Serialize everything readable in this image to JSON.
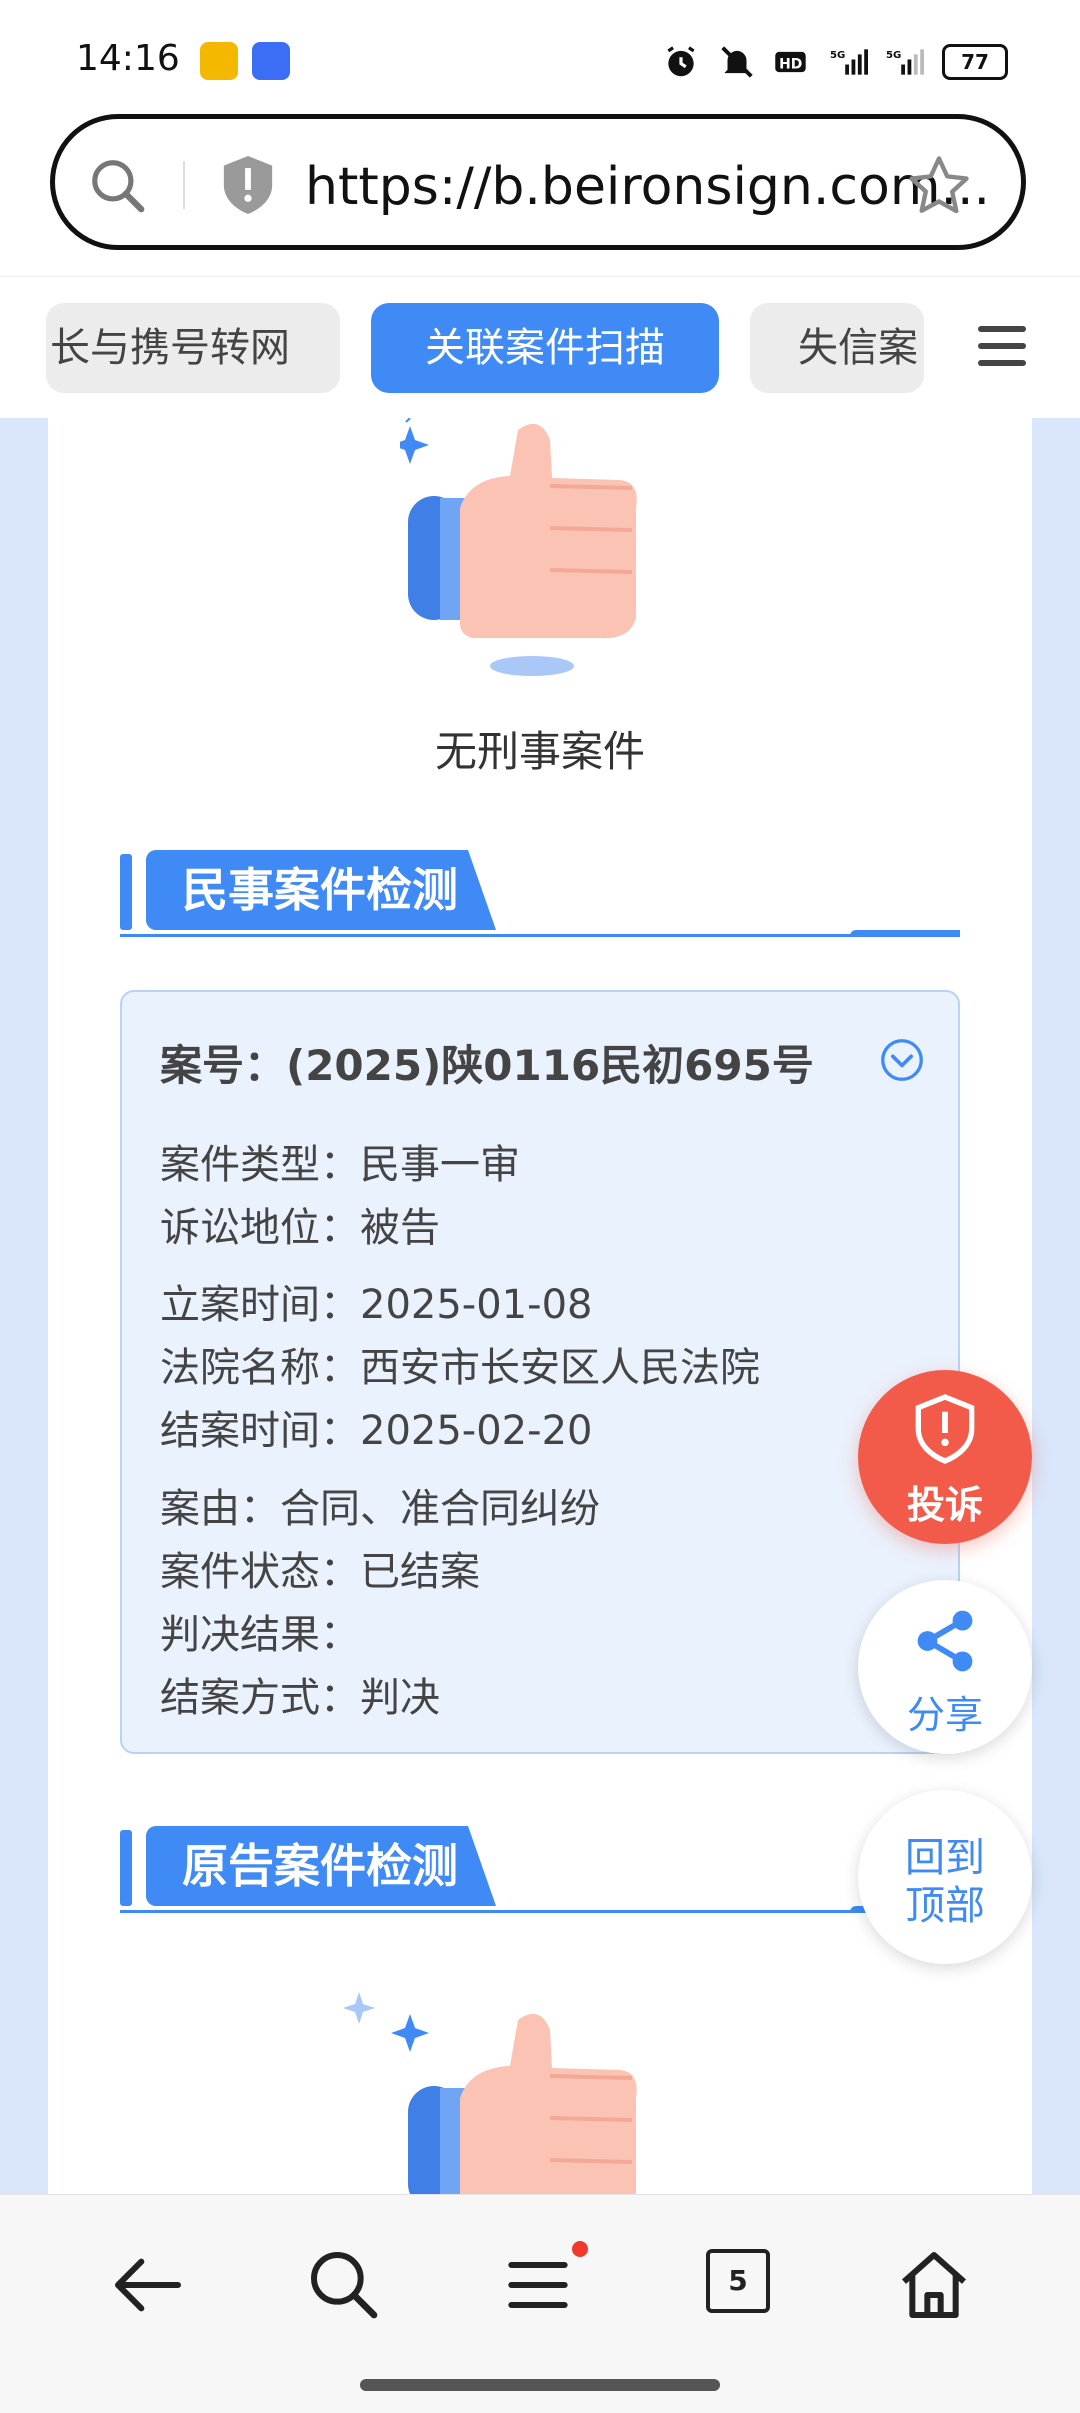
{
  "status_bar": {
    "time": "14:16",
    "battery": "77",
    "icons": [
      "app-game-icon",
      "app-chat-icon",
      "alarm-icon",
      "mute-icon",
      "hd-icon",
      "5g-signal-icon",
      "5g-signal-icon",
      "battery-icon"
    ]
  },
  "address_bar": {
    "url": "https://b.beironsign.com...",
    "icons": [
      "search-icon",
      "shield-icon",
      "star-icon"
    ]
  },
  "tabs": [
    {
      "label": "长与携号转网",
      "active": false
    },
    {
      "label": "关联案件扫描",
      "active": true
    },
    {
      "label": "失信案",
      "active": false
    }
  ],
  "criminal": {
    "result": "无刑事案件"
  },
  "civil": {
    "section_title": "民事案件检测",
    "case": {
      "case_no": "案号：(2025)陕0116民初695号",
      "rows": [
        {
          "label": "案件类型：",
          "value": "民事一审"
        },
        {
          "label": "诉讼地位：",
          "value": "被告"
        },
        {
          "label": "立案时间：",
          "value": "2025-01-08"
        },
        {
          "label": "法院名称：",
          "value": "西安市长安区人民法院"
        },
        {
          "label": "结案时间：",
          "value": "2025-02-20"
        },
        {
          "label": "案由：",
          "value": "合同、准合同纠纷"
        },
        {
          "label": "案件状态：",
          "value": "已结案"
        },
        {
          "label": "判决结果：",
          "value": ""
        },
        {
          "label": "结案方式：",
          "value": "判决"
        }
      ]
    }
  },
  "plaintiff": {
    "section_title": "原告案件检测"
  },
  "fabs": {
    "complain": "投诉",
    "share": "分享",
    "back_top_line1": "回到",
    "back_top_line2": "顶部"
  },
  "bottom_nav": {
    "tab_count": "5"
  },
  "colors": {
    "accent": "#3f8af4",
    "danger": "#f25b4a",
    "page_bg": "#d9e6fb",
    "case_bg": "#eaf2fd"
  }
}
